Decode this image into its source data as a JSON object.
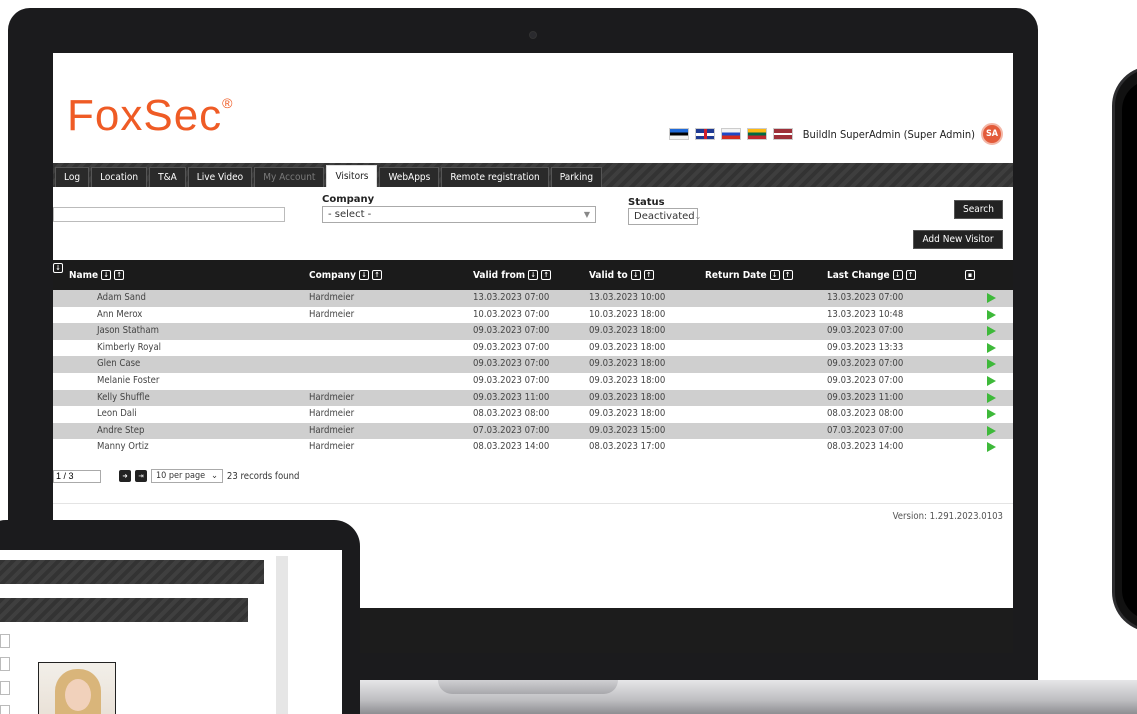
{
  "app": {
    "logo_text": "FoxSec",
    "logo_mark": "®",
    "brand_color": "#ef5b25"
  },
  "header": {
    "languages": [
      {
        "code": "ee",
        "icon": "estonia-flag-icon"
      },
      {
        "code": "uk",
        "icon": "uk-flag-icon"
      },
      {
        "code": "ru",
        "icon": "russia-flag-icon"
      },
      {
        "code": "lt",
        "icon": "lithuania-flag-icon"
      },
      {
        "code": "lv",
        "icon": "latvia-flag-icon"
      }
    ],
    "user_label": "BuildIn SuperAdmin (Super Admin)",
    "avatar_initials": "SA"
  },
  "nav": {
    "tabs": [
      {
        "label": "Log",
        "state": "normal"
      },
      {
        "label": "Location",
        "state": "normal"
      },
      {
        "label": "T&A",
        "state": "normal"
      },
      {
        "label": "Live Video",
        "state": "normal"
      },
      {
        "label": "My Account",
        "state": "disabled"
      },
      {
        "label": "Visitors",
        "state": "active"
      },
      {
        "label": "WebApps",
        "state": "normal"
      },
      {
        "label": "Remote registration",
        "state": "normal"
      },
      {
        "label": "Parking",
        "state": "normal"
      }
    ]
  },
  "filters": {
    "company_label": "Company",
    "company_value": "- select -",
    "status_label": "Status",
    "status_value": "Deactivated",
    "search_label": "Search",
    "add_label": "Add New Visitor"
  },
  "grid": {
    "columns": [
      "Name",
      "Company",
      "Valid from",
      "Valid to",
      "Return Date",
      "Last Change"
    ],
    "rows": [
      {
        "name": "Adam Sand",
        "company": "Hardmeier",
        "valid_from": "13.03.2023 07:00",
        "valid_to": "13.03.2023 10:00",
        "return_date": "",
        "last_change": "13.03.2023 07:00"
      },
      {
        "name": "Ann Merox",
        "company": "Hardmeier",
        "valid_from": "10.03.2023 07:00",
        "valid_to": "10.03.2023 18:00",
        "return_date": "",
        "last_change": "13.03.2023 10:48"
      },
      {
        "name": "Jason Statham",
        "company": "",
        "valid_from": "09.03.2023 07:00",
        "valid_to": "09.03.2023 18:00",
        "return_date": "",
        "last_change": "09.03.2023 07:00"
      },
      {
        "name": "Kimberly Royal",
        "company": "",
        "valid_from": "09.03.2023 07:00",
        "valid_to": "09.03.2023 18:00",
        "return_date": "",
        "last_change": "09.03.2023 13:33"
      },
      {
        "name": "Glen Case",
        "company": "",
        "valid_from": "09.03.2023 07:00",
        "valid_to": "09.03.2023 18:00",
        "return_date": "",
        "last_change": "09.03.2023 07:00"
      },
      {
        "name": "Melanie Foster",
        "company": "",
        "valid_from": "09.03.2023 07:00",
        "valid_to": "09.03.2023 18:00",
        "return_date": "",
        "last_change": "09.03.2023 07:00"
      },
      {
        "name": "Kelly Shuffle",
        "company": "Hardmeier",
        "valid_from": "09.03.2023 11:00",
        "valid_to": "09.03.2023 18:00",
        "return_date": "",
        "last_change": "09.03.2023 11:00"
      },
      {
        "name": "Leon Dali",
        "company": "Hardmeier",
        "valid_from": "08.03.2023 08:00",
        "valid_to": "09.03.2023 18:00",
        "return_date": "",
        "last_change": "08.03.2023 08:00"
      },
      {
        "name": "Andre Step",
        "company": "Hardmeier",
        "valid_from": "07.03.2023 07:00",
        "valid_to": "09.03.2023 15:00",
        "return_date": "",
        "last_change": "07.03.2023 07:00"
      },
      {
        "name": "Manny Ortiz",
        "company": "Hardmeier",
        "valid_from": "08.03.2023 14:00",
        "valid_to": "08.03.2023 17:00",
        "return_date": "",
        "last_change": "08.03.2023 14:00"
      }
    ]
  },
  "pager": {
    "page_value": "1 / 3",
    "per_page": "10 per page",
    "records_text": "23 records found"
  },
  "footer": {
    "version": "Version: 1.291.2023.0103"
  },
  "colors": {
    "row_alt": "#cfcfcf",
    "header_bg": "#1b1b1b",
    "play_green": "#3eb93a"
  }
}
